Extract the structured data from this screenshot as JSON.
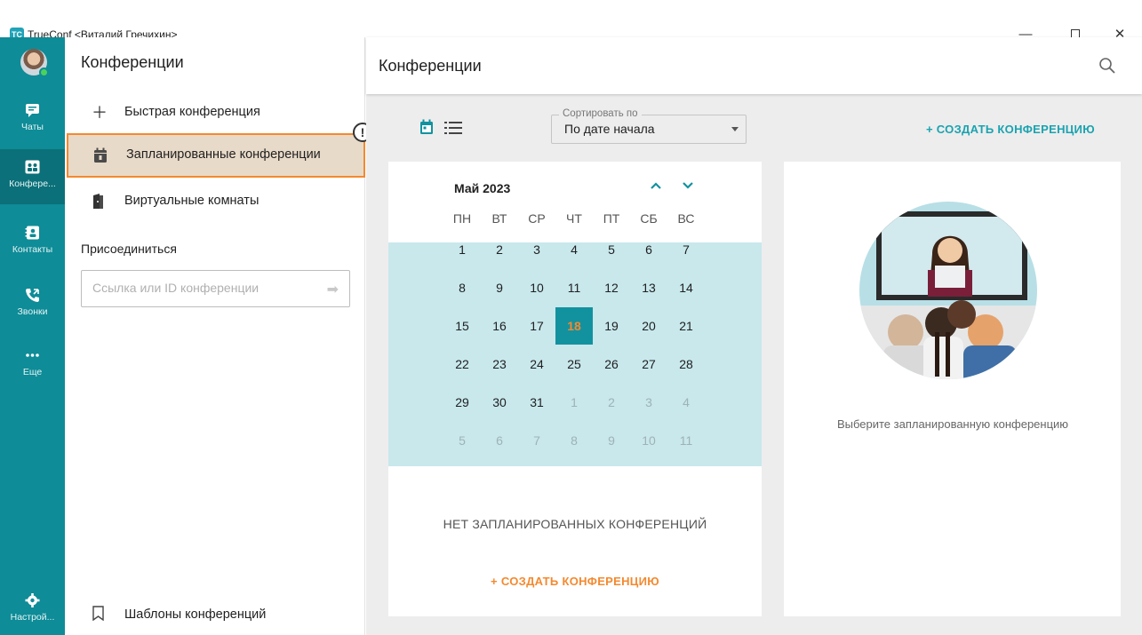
{
  "window": {
    "title": "TrueConf <Виталий Гречихин>",
    "app_icon": "trueconf-logo-icon",
    "controls": [
      "minimize-icon",
      "maximize-icon",
      "close-icon"
    ]
  },
  "rail": {
    "items": [
      {
        "id": "chats",
        "label": "Чаты",
        "icon": "chat-icon"
      },
      {
        "id": "conferences",
        "label": "Конфере...",
        "icon": "conference-icon",
        "active": true
      },
      {
        "id": "contacts",
        "label": "Контакты",
        "icon": "contacts-icon"
      },
      {
        "id": "calls",
        "label": "Звонки",
        "icon": "calls-icon"
      },
      {
        "id": "more",
        "label": "Еще",
        "icon": "more-icon"
      },
      {
        "id": "settings",
        "label": "Настрой...",
        "icon": "gear-icon"
      }
    ],
    "status_color": "#4cd25c"
  },
  "panel": {
    "title": "Конференции",
    "items": [
      {
        "label": "Быстрая конференция",
        "icon": "plus-icon"
      },
      {
        "label": "Запланированные конференции",
        "icon": "calendar-icon",
        "selected": true
      },
      {
        "label": "Виртуальные комнаты",
        "icon": "door-icon"
      }
    ],
    "warning_badge": "!",
    "join_label": "Присоединиться",
    "join_placeholder": "Ссылка или ID конференции",
    "templates_label": "Шаблоны конференций"
  },
  "main": {
    "title": "Конференции",
    "sort_legend": "Сортировать по",
    "sort_value": "По дате начала",
    "create_top": "+ СОЗДАТЬ КОНФЕРЕНЦИЮ",
    "calendar": {
      "month": "Май 2023",
      "weekdays": [
        "ПН",
        "ВТ",
        "СР",
        "ЧТ",
        "ПТ",
        "СБ",
        "ВС"
      ],
      "weeks": [
        [
          "1",
          "2",
          "3",
          "4",
          "5",
          "6",
          "7"
        ],
        [
          "8",
          "9",
          "10",
          "11",
          "12",
          "13",
          "14"
        ],
        [
          "15",
          "16",
          "17",
          "18",
          "19",
          "20",
          "21"
        ],
        [
          "22",
          "23",
          "24",
          "25",
          "26",
          "27",
          "28"
        ],
        [
          "29",
          "30",
          "31",
          "1",
          "2",
          "3",
          "4"
        ],
        [
          "5",
          "6",
          "7",
          "8",
          "9",
          "10",
          "11"
        ]
      ],
      "today": "18"
    },
    "no_conferences": "НЕТ ЗАПЛАНИРОВАННЫХ КОНФЕРЕНЦИЙ",
    "create_bottom": "+ СОЗДАТЬ КОНФЕРЕНЦИЮ",
    "info_text": "Выберите запланированную конференцию"
  },
  "colors": {
    "rail": "#0e8c97",
    "accent_teal": "#1aa3b0",
    "accent_orange": "#f4892f",
    "calendar_band": "#c8e8ec"
  }
}
